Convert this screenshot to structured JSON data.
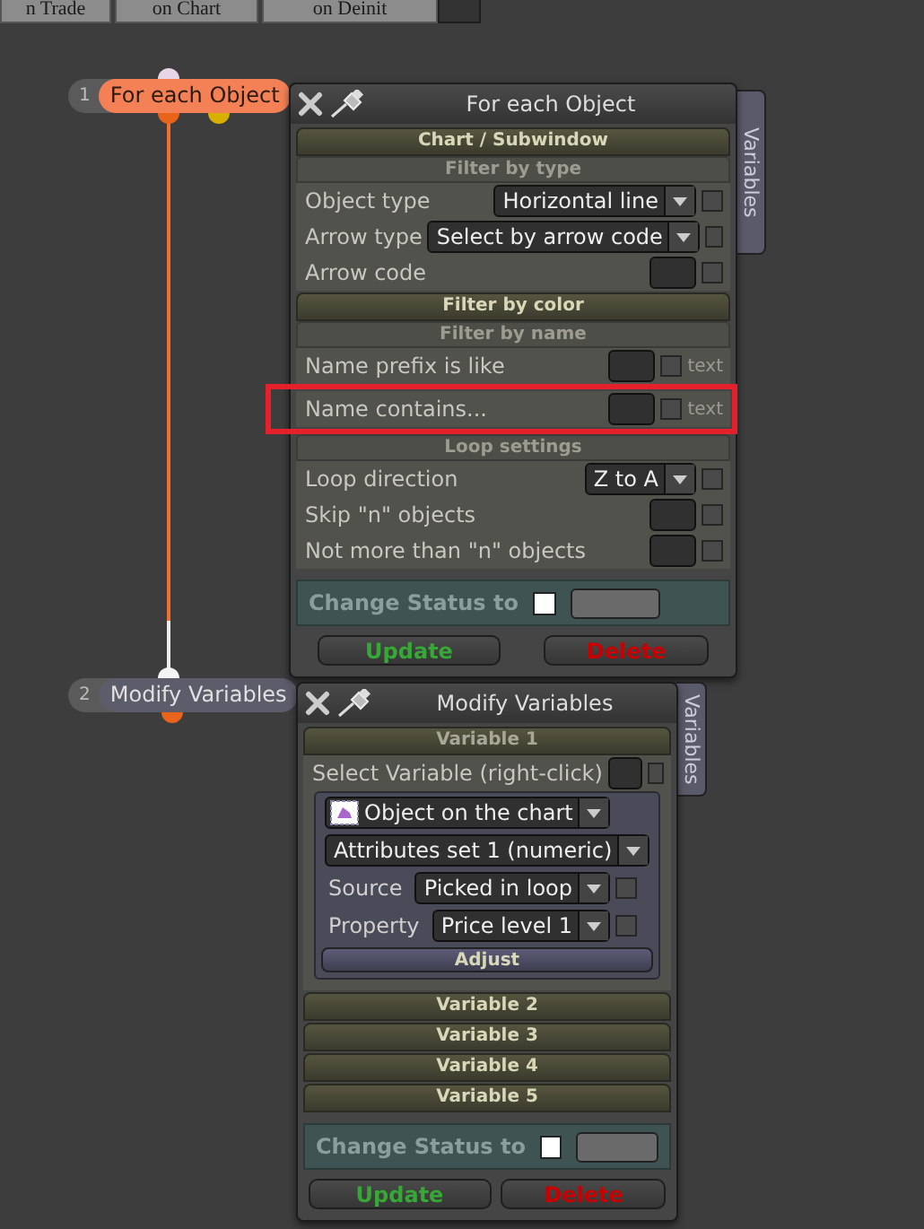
{
  "tabs": [
    {
      "label": "n Trade"
    },
    {
      "label": "on Chart"
    },
    {
      "label": "on Deinit"
    }
  ],
  "nodes": [
    {
      "number": "1",
      "label": "For each Object",
      "selected": true
    },
    {
      "number": "2",
      "label": "Modify Variables",
      "selected": false
    }
  ],
  "panel_1": {
    "title": "For each Object",
    "side_tab": "Variables",
    "blocks": [
      {
        "kind": "header",
        "title": "Chart / Subwindow"
      },
      {
        "kind": "subheader",
        "title": "Filter by type"
      },
      {
        "kind": "select",
        "label": "Object type",
        "value": "Horizontal line",
        "checked": false
      },
      {
        "kind": "select",
        "label": "Arrow type",
        "value": "Select by arrow code",
        "checked": false
      },
      {
        "kind": "field",
        "label": "Arrow code",
        "checked": false
      },
      {
        "kind": "header",
        "title": "Filter by color"
      },
      {
        "kind": "subheader",
        "title": "Filter by name"
      },
      {
        "kind": "field",
        "label": "Name prefix is like",
        "checked": false,
        "suffix": "text"
      },
      {
        "kind": "field",
        "label": "Name contains...",
        "checked": false,
        "suffix": "text",
        "highlighted": true
      },
      {
        "kind": "subheader",
        "title": "Loop settings"
      },
      {
        "kind": "select",
        "label": "Loop direction",
        "value": "Z to A",
        "checked": false
      },
      {
        "kind": "field",
        "label": "Skip \"n\" objects",
        "checked": false
      },
      {
        "kind": "field",
        "label": "Not more than \"n\" objects",
        "checked": false
      }
    ],
    "status": {
      "label": "Change Status to",
      "checked": false
    },
    "buttons": [
      {
        "kind": "update",
        "label": "Update"
      },
      {
        "kind": "delete",
        "label": "Delete"
      }
    ]
  },
  "panel_2": {
    "title": "Modify Variables",
    "side_tab": "Variables",
    "variables": [
      {
        "title": "Variable 1",
        "expanded": true,
        "select_label": "Select Variable (right-click)",
        "checked": false,
        "object": "Object on the chart",
        "attributes": "Attributes set 1 (numeric)",
        "rows": [
          {
            "label": "Source",
            "value": "Picked in loop",
            "checked": false
          },
          {
            "label": "Property",
            "value": "Price level 1",
            "checked": false
          }
        ],
        "action": "Adjust"
      },
      {
        "title": "Variable 2",
        "expanded": false
      },
      {
        "title": "Variable 3",
        "expanded": false
      },
      {
        "title": "Variable 4",
        "expanded": false
      },
      {
        "title": "Variable 5",
        "expanded": false
      }
    ],
    "status": {
      "label": "Change Status to",
      "checked": false
    },
    "buttons": [
      {
        "kind": "update",
        "label": "Update"
      },
      {
        "kind": "delete",
        "label": "Delete"
      }
    ]
  }
}
